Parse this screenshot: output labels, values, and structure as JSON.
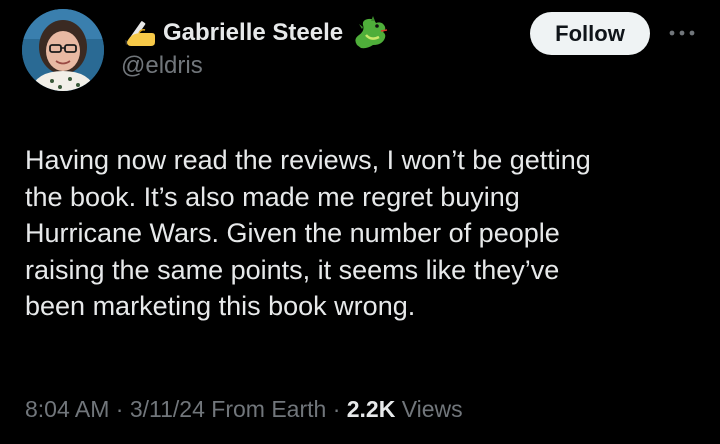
{
  "author": {
    "display_name": "Gabrielle Steele",
    "handle": "@eldris",
    "name_prefix_emoji": "writing-hand-icon",
    "name_suffix_emoji": "dragon-icon"
  },
  "actions": {
    "follow_label": "Follow",
    "more_icon": "more-options-icon"
  },
  "tweet": {
    "lines": [
      "Having now read the reviews, I won’t be getting",
      "the book. It’s also made me regret buying",
      "Hurricane Wars. Given the number of people",
      "raising the same points, it seems like they’ve",
      "been marketing this book wrong."
    ]
  },
  "meta": {
    "time": "8:04 AM",
    "date": "3/11/24",
    "location": "From Earth",
    "separator": "·",
    "views_count": "2.2K",
    "views_label": "Views"
  },
  "colors": {
    "background": "#000000",
    "primary_text": "#e7e9ea",
    "secondary_text": "#71767b",
    "follow_bg": "#eff3f4",
    "follow_text": "#0f1419"
  }
}
